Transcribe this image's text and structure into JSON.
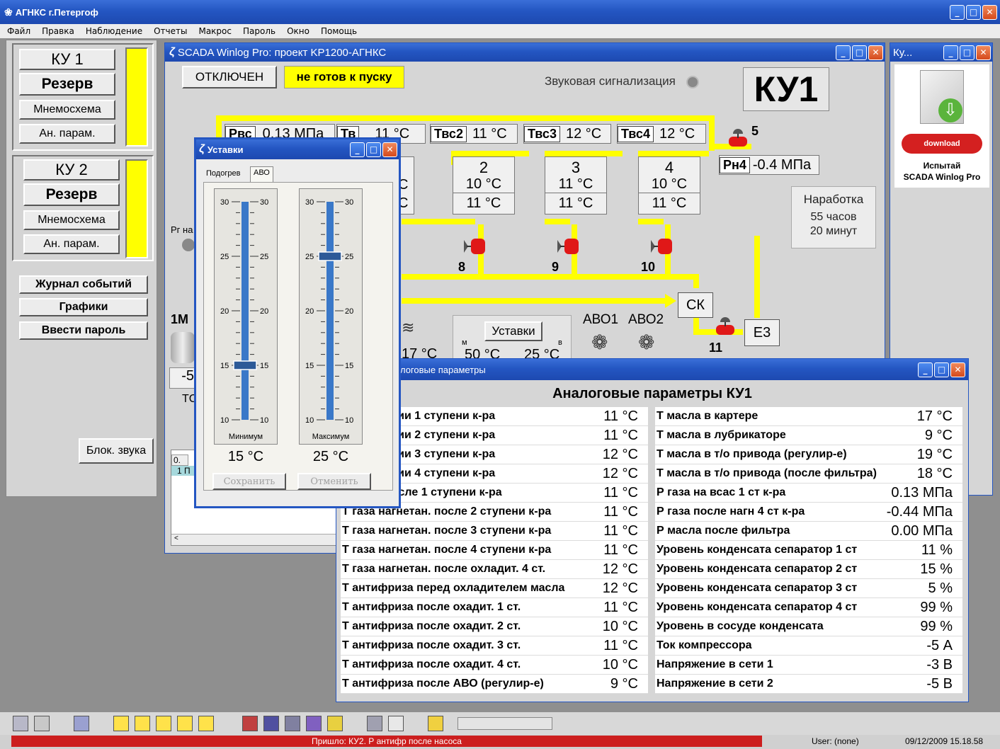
{
  "app": {
    "title": "АГНКС г.Петергоф"
  },
  "menu": [
    "Файл",
    "Правка",
    "Наблюдение",
    "Отчеты",
    "Макрос",
    "Пароль",
    "Окно",
    "Помощь"
  ],
  "left_panel": {
    "units": [
      {
        "name": "КУ 1",
        "mode": "Резерв",
        "mnemo": "Мнемосхема",
        "params": "Ан. парам."
      },
      {
        "name": "КУ 2",
        "mode": "Резерв",
        "mnemo": "Мнемосхема",
        "params": "Ан. парам."
      }
    ],
    "journal": "Журнал событий",
    "charts": "Графики",
    "password": "Ввести пароль",
    "mute": "Блок. звука"
  },
  "scada": {
    "title": "SCADA Winlog Pro: проект KP1200-АГНКС",
    "status_off": "ОТКЛЮЧЕН",
    "status_ready": "не готов к пуску",
    "sound_label": "Звуковая сигнализация",
    "unit_label": "КУ1",
    "rvs_tag": "Рвс",
    "rvs_val": "0.13 МПа",
    "tv_tag": "Тв",
    "tv_val": "11 °C",
    "tvs2_tag": "Твс2",
    "tvs2_val": "11 °C",
    "tvs3_tag": "Твс3",
    "tvs3_val": "12 °C",
    "tvs4_tag": "Твс4",
    "tvs4_val": "12 °C",
    "rn4_tag": "Рн4",
    "rn4_val": "-0.4 МПа",
    "valve5": "5",
    "valve8": "8",
    "valve9": "9",
    "valve10": "10",
    "valve11": "11",
    "stages": [
      {
        "num": "2",
        "t1": "10 °C",
        "t2": "11 °C"
      },
      {
        "num": "3",
        "t1": "11 °C",
        "t2": "11 °C"
      },
      {
        "num": "4",
        "t1": "10 °C",
        "t2": "11 °C"
      }
    ],
    "stage1_frag1": "C",
    "stage1_frag2": "C",
    "runtime_title": "Наработка",
    "runtime_hours": "55 часов",
    "runtime_min": "20 минут",
    "ck": "СК",
    "e3": "Е3",
    "setpoints_btn": "Уставки",
    "sp_m": "м",
    "sp_v": "в",
    "sp_min": "50 °C",
    "sp_max": "25 °C",
    "t17": "17 °C",
    "avo1": "АВО1",
    "avo2": "АВО2",
    "rg_frag": "Рг на",
    "motor": "1M",
    "minus_frag": "-5",
    "tc_frag": "ТС",
    "list_frag1": "0.",
    "list_frag2": "1 П"
  },
  "ku_window": {
    "title": "Ку...",
    "download": "download",
    "promo1": "Испытай",
    "promo2": "SCADA Winlog Pro"
  },
  "ustavki": {
    "title": "Уставки",
    "tab1": "Подогрев",
    "tab2": "АВО",
    "ticks": [
      "30",
      "25",
      "20",
      "15",
      "10"
    ],
    "min_label": "Минимум",
    "max_label": "Максимум",
    "min_val": "15 °C",
    "max_val": "25 °C",
    "min_level": 15,
    "max_level": 25,
    "save": "Сохранить",
    "cancel": "Отменить"
  },
  "analog": {
    "window_title": "логовые параметры",
    "heading": "Аналоговые параметры КУ1",
    "left": [
      {
        "n": "всасывании 1 ступени к-ра",
        "v": "11 °C"
      },
      {
        "n": "всасывании 2 ступени к-ра",
        "v": "11 °C"
      },
      {
        "n": "всасывании 3 ступени к-ра",
        "v": "12 °C"
      },
      {
        "n": "всасывании 4 ступени к-ра",
        "v": "12 °C"
      },
      {
        "n": "гнетан. после 1 ступени к-ра",
        "v": "11 °C"
      },
      {
        "n": "Т газа нагнетан. после 2 ступени к-ра",
        "v": "11 °C"
      },
      {
        "n": "Т газа нагнетан. после 3 ступени к-ра",
        "v": "11 °C"
      },
      {
        "n": "Т газа нагнетан. после 4 ступени к-ра",
        "v": "11 °C"
      },
      {
        "n": "Т газа нагнетан. после охладит. 4 ст.",
        "v": "12 °C"
      },
      {
        "n": "Т антифриза перед охладителем масла",
        "v": "12 °C"
      },
      {
        "n": "Т антифриза после охадит. 1 ст.",
        "v": "11 °C"
      },
      {
        "n": "Т антифриза после охадит. 2 ст.",
        "v": "10 °C"
      },
      {
        "n": "Т антифриза после охадит. 3 ст.",
        "v": "11 °C"
      },
      {
        "n": "Т антифриза после охадит. 4 ст.",
        "v": "10 °C"
      },
      {
        "n": "Т антифриза после АВО (регулир-е)",
        "v": "9 °C"
      }
    ],
    "right": [
      {
        "n": "Т масла в картере",
        "v": "17 °C"
      },
      {
        "n": "Т масла в лубрикаторе",
        "v": "9 °C"
      },
      {
        "n": "Т масла в т/о привода (регулир-е)",
        "v": "19 °C"
      },
      {
        "n": "Т масла в т/о привода (после фильтра)",
        "v": "18 °C"
      },
      {
        "n": "Р газа на всас 1 ст к-ра",
        "v": "0.13 МПа"
      },
      {
        "n": "Р газа после нагн 4 ст к-ра",
        "v": "-0.44 МПа"
      },
      {
        "n": "Р масла после фильтра",
        "v": "0.00 МПа"
      },
      {
        "n": "Уровень конденсата сепаратор 1 ст",
        "v": "11 %"
      },
      {
        "n": "Уровень конденсата сепаратор 2 ст",
        "v": "15 %"
      },
      {
        "n": "Уровень конденсата сепаратор 3 ст",
        "v": "5 %"
      },
      {
        "n": "Уровень конденсата сепаратор 4 ст",
        "v": "99 %"
      },
      {
        "n": "Уровень в сосуде конденсата",
        "v": "99 %"
      },
      {
        "n": "Ток компрессора",
        "v": "-5 А"
      },
      {
        "n": "Напряжение в сети 1",
        "v": "-3 В"
      },
      {
        "n": "Напряжение в сети 2",
        "v": "-5 В"
      }
    ]
  },
  "statusbar": {
    "message": "Пришло: КУ2. Р антифр после насоса",
    "user": "User: (none)",
    "datetime": "09/12/2009 15.18.58"
  },
  "colors": {
    "accent": "#ffff00",
    "alarm": "#cc1e1e",
    "titlebar": "#2456c2"
  }
}
